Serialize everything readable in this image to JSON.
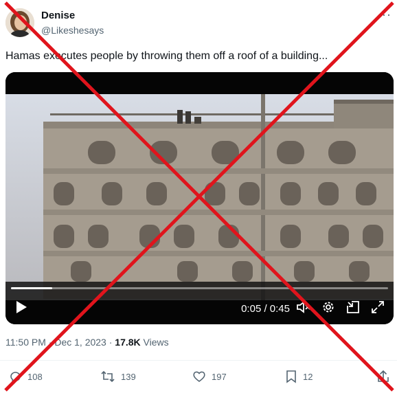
{
  "author": {
    "name": "Denise",
    "handle": "@Likeshesays"
  },
  "tweet": {
    "text": "Hamas executes people by throwing them off a roof of a building..."
  },
  "video": {
    "current_time": "0:05",
    "duration": "0:45",
    "time_display": "0:05 / 0:45",
    "progress": 0.11
  },
  "meta": {
    "time": "11:50 PM",
    "separator": "·",
    "date": "Dec 1, 2023",
    "views_count": "17.8K",
    "views_label": "Views"
  },
  "actions": {
    "replies": "108",
    "reposts": "139",
    "likes": "197",
    "bookmarks": "12"
  },
  "colors": {
    "overlay_x": "#e0141c",
    "secondary_text": "#536471"
  }
}
